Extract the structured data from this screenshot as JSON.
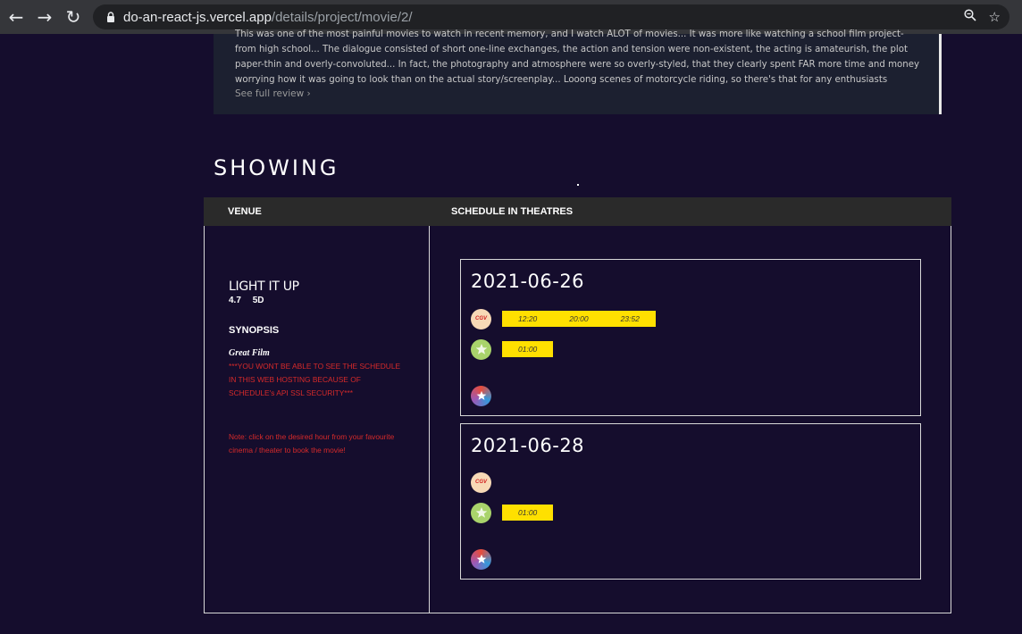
{
  "browser": {
    "url_host": "do-an-react-js.vercel.app",
    "url_path": "/details/project/movie/2/"
  },
  "review": {
    "text": "This was one of the most painful movies to watch in recent memory, and I watch ALOT of movies... It was more like watching a school film project- from high school... The dialogue consisted of short one-line exchanges, the action and tension were non-existent, the acting is amateurish, the plot paper-thin and overly-convoluted... In fact, the photography and atmosphere were so overly-styled, that they clearly spent FAR more time and money worrying how it was going to look than on the actual story/screenplay... Looong scenes of motorcycle riding, so there's that for any enthusiasts",
    "see_full": "See full review  ›"
  },
  "showing": {
    "title": "SHOWING",
    "col_venue": "VENUE",
    "col_schedule": "SCHEDULE IN THEATRES"
  },
  "movie": {
    "title": "LIGHT IT UP",
    "rating": "4.7",
    "format": "5D",
    "synopsis_label": "SYNOPSIS",
    "synopsis_sub": "Great Film",
    "warning": "***YOU WONT BE ABLE TO SEE THE SCHEDULE IN THIS WEB HOSTING BECAUSE OF SCHEDULE's API SSL SECURITY***",
    "note": "Note: click on the desired hour from your favourite cinema / theater to book the movie!"
  },
  "schedule": [
    {
      "date": "2021-06-26",
      "cinemas": [
        {
          "logo": "cgv-logo-icon",
          "logo_text": "CGV",
          "times": [
            "12:20",
            "20:00",
            "23:52"
          ]
        },
        {
          "logo": "star-cinema-logo-icon",
          "logo_text": "",
          "times": [
            "01:00"
          ]
        },
        {
          "logo": "galaxy-cinema-logo-icon",
          "logo_text": "",
          "times": []
        }
      ]
    },
    {
      "date": "2021-06-28",
      "cinemas": [
        {
          "logo": "cgv-logo-icon",
          "logo_text": "CGV",
          "times": []
        },
        {
          "logo": "star-cinema-logo-icon",
          "logo_text": "",
          "times": [
            "01:00"
          ]
        },
        {
          "logo": "galaxy-cinema-logo-icon",
          "logo_text": "",
          "times": []
        }
      ]
    }
  ]
}
